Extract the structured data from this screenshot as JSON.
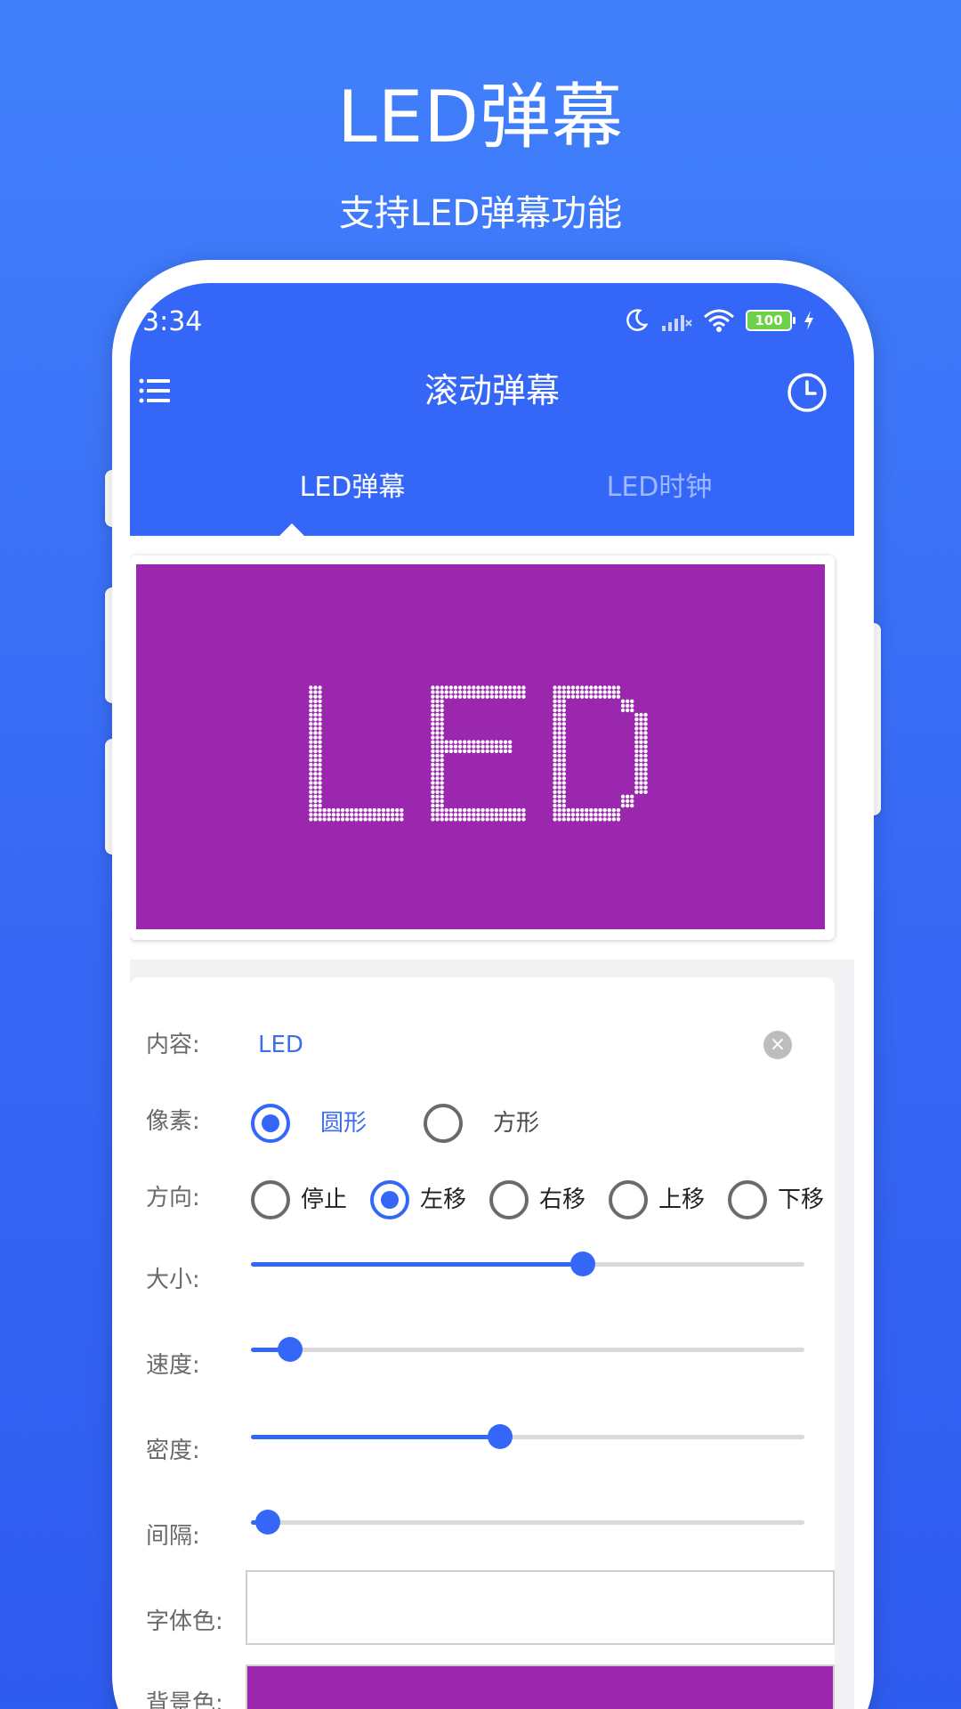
{
  "promo": {
    "headline": "LED弹幕",
    "subheadline": "支持LED弹幕功能"
  },
  "status_bar": {
    "time": "3:34",
    "battery": "100"
  },
  "app_bar": {
    "title": "滚动弹幕"
  },
  "tabs": [
    {
      "label": "LED弹幕",
      "selected": true
    },
    {
      "label": "LED时钟",
      "selected": false
    }
  ],
  "preview": {
    "text": "LED",
    "background_color": "#9B27AF",
    "pixel_color": "#FFFFFF"
  },
  "settings": {
    "content": {
      "label": "内容:",
      "value": "LED"
    },
    "pixel": {
      "label": "像素:",
      "options": [
        "圆形",
        "方形"
      ],
      "selected": "圆形"
    },
    "direction": {
      "label": "方向:",
      "options": [
        "停止",
        "左移",
        "右移",
        "上移",
        "下移"
      ],
      "selected": "左移"
    },
    "size": {
      "label": "大小:",
      "value": 0.6
    },
    "speed": {
      "label": "速度:",
      "value": 0.07
    },
    "density": {
      "label": "密度:",
      "value": 0.45
    },
    "interval": {
      "label": "间隔:",
      "value": 0.03
    },
    "font_color": {
      "label": "字体色:",
      "value": "#FFFFFF"
    },
    "background_color": {
      "label": "背景色:",
      "value": "#9B27AF"
    }
  },
  "colors": {
    "accent": "#3467F7",
    "background_gradient_top": "#4180FB",
    "background_gradient_bottom": "#2F5CF0"
  }
}
